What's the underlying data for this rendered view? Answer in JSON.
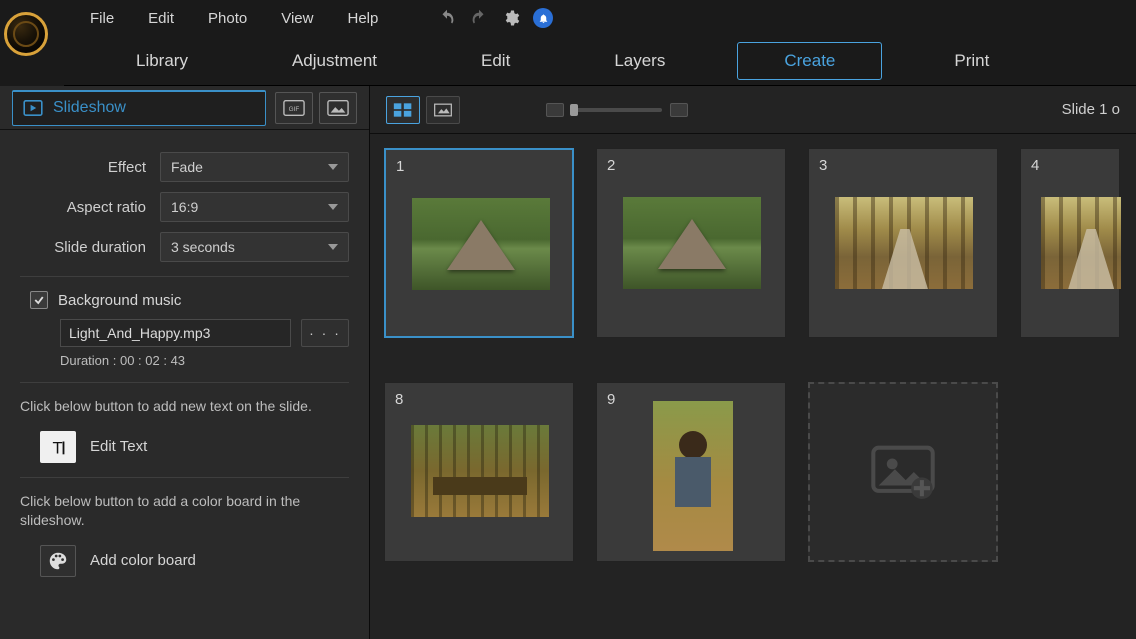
{
  "menu": {
    "file": "File",
    "edit": "Edit",
    "photo": "Photo",
    "view": "View",
    "help": "Help"
  },
  "mainTabs": {
    "library": "Library",
    "adjustment": "Adjustment",
    "edit": "Edit",
    "layers": "Layers",
    "create": "Create",
    "print": "Print"
  },
  "panel": {
    "title": "Slideshow",
    "fields": {
      "effect_label": "Effect",
      "effect_value": "Fade",
      "aspect_label": "Aspect ratio",
      "aspect_value": "16:9",
      "duration_label": "Slide duration",
      "duration_value": "3 seconds"
    },
    "music": {
      "check_label": "Background music",
      "file": "Light_And_Happy.mp3",
      "duration_label": "Duration : 00 : 02 : 43"
    },
    "text_hint": "Click below button to add new text on the slide.",
    "edit_text_label": "Edit Text",
    "color_hint": "Click below button to add a color board in the slideshow.",
    "add_color_label": "Add color board"
  },
  "workspace": {
    "counter": "Slide  1 o",
    "slides": [
      "1",
      "2",
      "3",
      "4",
      "8",
      "9"
    ]
  }
}
